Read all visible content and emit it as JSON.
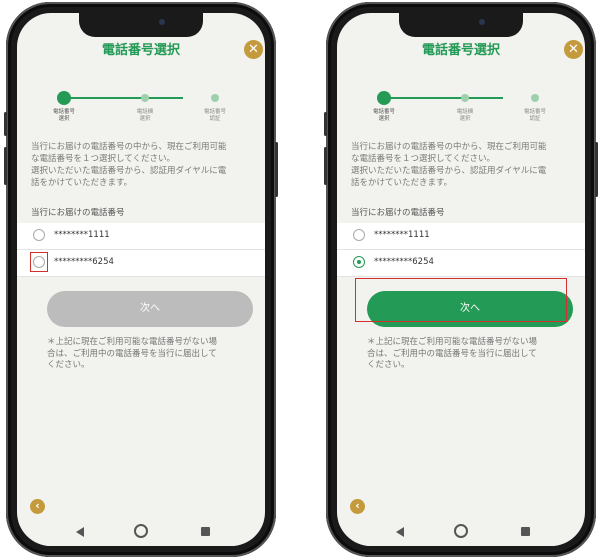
{
  "screens": [
    {
      "title": "電話番号選択",
      "close_icon": "close-icon",
      "steps": [
        {
          "label_line1": "電話番号",
          "label_line2": "選択"
        },
        {
          "label_line1": "電話機",
          "label_line2": "選択"
        },
        {
          "label_line1": "電話番号",
          "label_line2": "認証"
        }
      ],
      "description": [
        "当行にお届けの電話番号の中から、現在ご利用可能",
        "な電話番号を１つ選択してください。",
        "選択いただいた電話番号から、認証用ダイヤルに電",
        "話をかけていただきます。"
      ],
      "section_title": "当行にお届けの電話番号",
      "options": [
        {
          "number": "********1111",
          "selected": false
        },
        {
          "number": "*********6254",
          "selected": false
        }
      ],
      "next_label": "次へ",
      "next_enabled": false,
      "note": [
        "＊上記に現在ご利用可能な電話番号がない場",
        "合は、ご利用中の電話番号を当行に届出して",
        "ください。"
      ]
    },
    {
      "title": "電話番号選択",
      "close_icon": "close-icon",
      "steps": [
        {
          "label_line1": "電話番号",
          "label_line2": "選択"
        },
        {
          "label_line1": "電話機",
          "label_line2": "選択"
        },
        {
          "label_line1": "電話番号",
          "label_line2": "認証"
        }
      ],
      "description": [
        "当行にお届けの電話番号の中から、現在ご利用可能",
        "な電話番号を１つ選択してください。",
        "選択いただいた電話番号から、認証用ダイヤルに電",
        "話をかけていただきます。"
      ],
      "section_title": "当行にお届けの電話番号",
      "options": [
        {
          "number": "********1111",
          "selected": false
        },
        {
          "number": "*********6254",
          "selected": true
        }
      ],
      "next_label": "次へ",
      "next_enabled": true,
      "note": [
        "＊上記に現在ご利用可能な電話番号がない場",
        "合は、ご利用中の電話番号を当行に届出して",
        "ください。"
      ]
    }
  ],
  "colors": {
    "accent": "#239a55",
    "gold": "#c49a3c",
    "highlight": "#d32f2f",
    "disabled": "#bcbcbc"
  }
}
